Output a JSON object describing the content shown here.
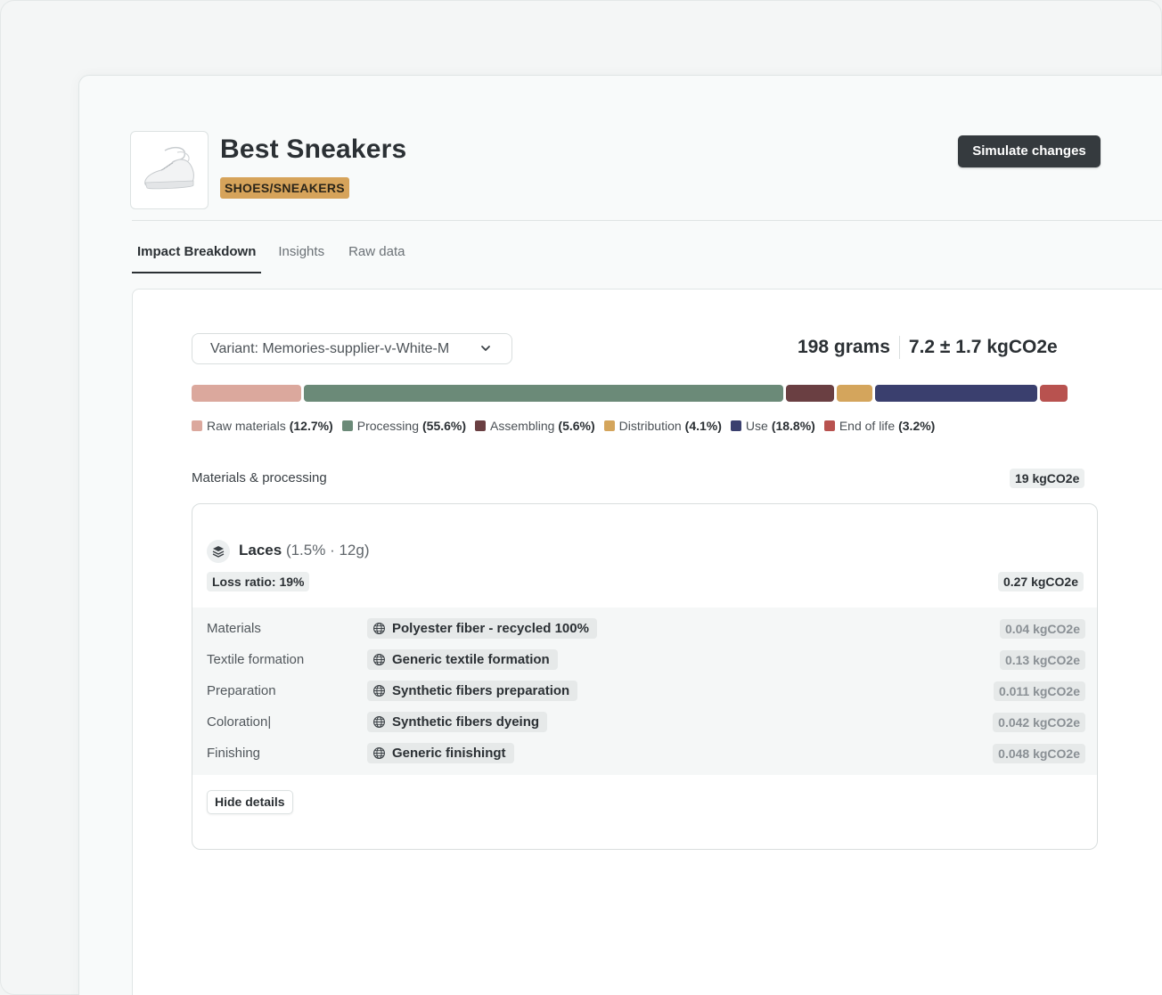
{
  "product": {
    "title": "Best Sneakers",
    "category": "SHOES/SNEAKERS",
    "image_icon": "sneaker-image"
  },
  "header": {
    "simulate_label": "Simulate changes"
  },
  "tabs": [
    {
      "label": "Impact Breakdown",
      "active": true
    },
    {
      "label": "Insights",
      "active": false
    },
    {
      "label": "Raw data",
      "active": false
    }
  ],
  "variant": {
    "label": "Variant: Memories-supplier-v-White-M"
  },
  "totals": {
    "weight": "198 grams",
    "impact": "7.2 ± 1.7 kgCO2e"
  },
  "breakdown": [
    {
      "name": "Raw materials",
      "pct": "(12.7%)",
      "share": 12.7,
      "color": "#dba89d"
    },
    {
      "name": "Processing",
      "pct": "(55.6%)",
      "share": 55.6,
      "color": "#6b8a78"
    },
    {
      "name": "Assembling",
      "pct": "(5.6%)",
      "share": 5.6,
      "color": "#6a3f42"
    },
    {
      "name": "Distribution",
      "pct": "(4.1%)",
      "share": 4.1,
      "color": "#d4a55c"
    },
    {
      "name": "Use",
      "pct": "(18.8%)",
      "share": 18.8,
      "color": "#3a3f6e"
    },
    {
      "name": "End of life",
      "pct": "(3.2%)",
      "share": 3.2,
      "color": "#b8524f"
    }
  ],
  "section": {
    "label": "Materials & processing",
    "total": "19 kgCO2e"
  },
  "component": {
    "icon": "layers-icon",
    "name": "Laces",
    "meta": "(1.5% · 12g)",
    "loss_ratio": "Loss ratio: 19%",
    "total": "0.27 kgCO2e",
    "steps": [
      {
        "label": "Materials",
        "process": "Polyester fiber - recycled 100%",
        "value": "0.04 kgCO2e"
      },
      {
        "label": "Textile formation",
        "process": "Generic textile formation",
        "value": "0.13 kgCO2e"
      },
      {
        "label": "Preparation",
        "process": "Synthetic fibers preparation",
        "value": "0.011 kgCO2e"
      },
      {
        "label": "Coloration|",
        "process": "Synthetic fibers dyeing",
        "value": "0.042 kgCO2e"
      },
      {
        "label": "Finishing",
        "process": "Generic finishingt",
        "value": "0.048 kgCO2e"
      }
    ],
    "hide_label": "Hide details"
  }
}
